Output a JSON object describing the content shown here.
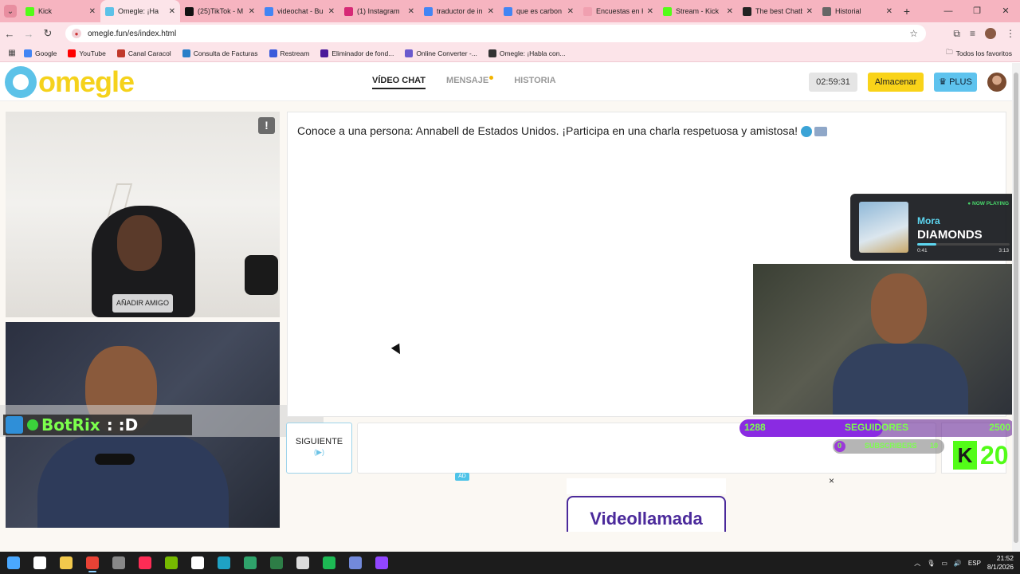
{
  "browser": {
    "tabs": [
      {
        "label": "Kick",
        "color": "#53fc18",
        "active": false
      },
      {
        "label": "Omegle: ¡Ha",
        "color": "#5cc2e8",
        "active": true
      },
      {
        "label": "(25)TikTok - M",
        "color": "#111111",
        "active": false
      },
      {
        "label": "videochat - Bu",
        "color": "#4285f4",
        "active": false
      },
      {
        "label": "(1) Instagram",
        "color": "#d62976",
        "active": false
      },
      {
        "label": "traductor de in",
        "color": "#4285f4",
        "active": false
      },
      {
        "label": "que es carbon",
        "color": "#4285f4",
        "active": false
      },
      {
        "label": "Encuestas en K",
        "color": "#f0a0b0",
        "active": false
      },
      {
        "label": "Stream - Kick",
        "color": "#53fc18",
        "active": false
      },
      {
        "label": "The best Chatb",
        "color": "#222222",
        "active": false
      },
      {
        "label": "Historial",
        "color": "#666666",
        "active": false
      }
    ],
    "url": "omegle.fun/es/index.html",
    "bookmarks": [
      {
        "label": "Google",
        "color": "#4285f4"
      },
      {
        "label": "YouTube",
        "color": "#ff0000"
      },
      {
        "label": "Canal Caracol",
        "color": "#c0392b"
      },
      {
        "label": "Consulta de Facturas",
        "color": "#2a7fc8"
      },
      {
        "label": "Restream",
        "color": "#3b5bdb"
      },
      {
        "label": "Eliminador de fond...",
        "color": "#4a1a9a"
      },
      {
        "label": "Online Converter -...",
        "color": "#6a5acd"
      },
      {
        "label": "Omegle: ¡Habla con...",
        "color": "#333333"
      }
    ],
    "bookmarks_all": "Todos los favoritos"
  },
  "site": {
    "logo": "omegle",
    "nav": {
      "video": "VÍDEO CHAT",
      "message": "MENSAJE",
      "history": "HISTORIA"
    },
    "timer": "02:59:31",
    "store": "Almacenar",
    "plus": "PLUS"
  },
  "stranger": {
    "add_friend": "AÑADIR AMIGO",
    "flag": "!"
  },
  "chat": {
    "message": "Conoce a una persona: Annabell de Estados Unidos. ¡Participa en una charla respetuosa y amistosa!",
    "next": "SIGUIENTE",
    "next_hint": "(▶)",
    "input_value": ""
  },
  "ad": {
    "badge": "AD",
    "close": "×",
    "banner": "Videollamada"
  },
  "overlay": {
    "botrix_name": "BotRix",
    "botrix_msg": ": :D",
    "now_playing": {
      "tag": "● NOW PLAYING",
      "artist": "Mora",
      "title": "DIAMONDS",
      "elapsed": "0:41",
      "duration": "3:13",
      "progress": 0.21
    },
    "followers": {
      "current": "1288",
      "label": "SEGUIDORES",
      "goal": "2500",
      "progress": 0.52
    },
    "subs": {
      "current": "0",
      "label": "SUBSCRIBERS",
      "goal": "10"
    },
    "kick_count": "20"
  },
  "taskbar": {
    "apps": [
      {
        "name": "windows-icon",
        "color": "#4aa8ff"
      },
      {
        "name": "search-icon",
        "color": "#ffffff"
      },
      {
        "name": "file-explorer-icon",
        "color": "#f2c94c"
      },
      {
        "name": "chrome-icon",
        "color": "#e94235",
        "active": true
      },
      {
        "name": "cod-icon",
        "color": "#888888"
      },
      {
        "name": "tiktok-icon",
        "color": "#fe2c55"
      },
      {
        "name": "nvidia-icon",
        "color": "#76b900"
      },
      {
        "name": "tf-icon",
        "color": "#ffffff"
      },
      {
        "name": "edge-icon",
        "color": "#1fa2c4"
      },
      {
        "name": "store-icon",
        "color": "#2fa36b"
      },
      {
        "name": "terminal-icon",
        "color": "#2d7d46"
      },
      {
        "name": "obs-icon",
        "color": "#dddddd"
      },
      {
        "name": "spotify-icon",
        "color": "#1db954"
      },
      {
        "name": "discord-icon",
        "color": "#7289da"
      },
      {
        "name": "twitch-icon",
        "color": "#9146ff"
      }
    ],
    "lang": "ESP",
    "time": "21:52",
    "date": "8/1/2026"
  }
}
